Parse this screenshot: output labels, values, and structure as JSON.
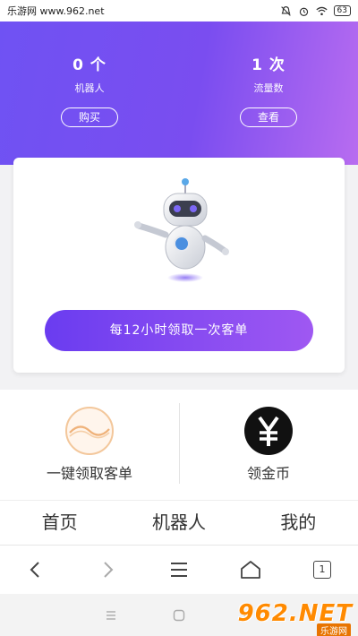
{
  "status_bar": {
    "left_text": "乐游网 www.962.net",
    "battery": "63",
    "icons": [
      "mute-icon",
      "alarm-icon",
      "wifi-icon",
      "battery-icon"
    ]
  },
  "header": {
    "robots": {
      "value": "0 个",
      "label": "机器人",
      "button": "购买"
    },
    "traffic": {
      "value": "1 次",
      "label": "流量数",
      "button": "查看"
    },
    "colors": {
      "start": "#6f52f3",
      "end": "#b86cf0"
    }
  },
  "card": {
    "image": "robot-illustration",
    "cta_label": "每12小时领取一次客单"
  },
  "features": [
    {
      "label": "一键领取客单",
      "icon": "wave-circle-icon"
    },
    {
      "label": "领金币",
      "icon": "yuan-coin-icon"
    }
  ],
  "tabs": [
    "首页",
    "机器人",
    "我的"
  ],
  "browser_nav": {
    "tab_count": "1",
    "icons": [
      "back-icon",
      "forward-icon",
      "menu-icon",
      "home-icon",
      "tabs-icon"
    ]
  },
  "watermark": {
    "main": "962.NET",
    "sub": "乐游网"
  }
}
